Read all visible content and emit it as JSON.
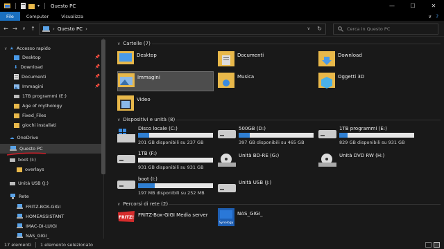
{
  "titlebar": {
    "title": "Questo PC",
    "min": "—",
    "max": "☐",
    "close": "✕"
  },
  "ribbon": {
    "tabs": [
      "File",
      "Computer",
      "Visualizza"
    ],
    "expand": "∨",
    "help": "?"
  },
  "address": {
    "back": "←",
    "forward": "→",
    "recent": "∨",
    "up": "↑",
    "crumb": "Questo PC",
    "chevron": "›",
    "search_placeholder": "Cerca in Questo PC"
  },
  "nav": {
    "quick_access": "Accesso rapido",
    "quick_items": [
      "Desktop",
      "Download",
      "Documenti",
      "Immagini",
      "1TB programmi (E:)",
      "Age of mythology",
      "Fixed_Files",
      "giochi installati"
    ],
    "onedrive": "OneDrive",
    "this_pc": "Questo PC",
    "boot": "boot (I:)",
    "overlays": "overlays",
    "usb": "Unità USB (J:)",
    "network": "Rete",
    "network_items": [
      "FRITZ-BOX-GIGI",
      "HOMEASSISTANT",
      "IMAC-DI-LUIGI",
      "NAS_GIGI_"
    ]
  },
  "content": {
    "folders_header": "Cartelle (7)",
    "folders": [
      "Desktop",
      "Documenti",
      "Download",
      "Immagini",
      "Musica",
      "Oggetti 3D",
      "Video"
    ],
    "drives_header": "Dispositivi e unità (8)",
    "drives": [
      {
        "name": "Disco locale (C:)",
        "info": "201 GB disponibili su 237 GB",
        "used": 0.15
      },
      {
        "name": "500GB (D:)",
        "info": "397 GB disponibili su 465 GB",
        "used": 0.15
      },
      {
        "name": "1TB programmi (E:)",
        "info": "829 GB disponibili su 931 GB",
        "used": 0.11
      },
      {
        "name": "1TB (F:)",
        "info": "931 GB disponibili su 931 GB",
        "used": 0.0
      },
      {
        "name": "Unità BD-RE (G:)",
        "info": ""
      },
      {
        "name": "Unità DVD RW (H:)",
        "info": ""
      },
      {
        "name": "boot (I:)",
        "info": "197 MB disponibili su 252 MB",
        "used": 0.22
      },
      {
        "name": "Unità USB (J:)",
        "info": ""
      }
    ],
    "network_header": "Percorsi di rete (2)",
    "network": [
      "FRITZ-Box-GIGI Media server",
      "NAS_GIGI_"
    ],
    "fritz_logo": "FRITZ!",
    "nas_logo": "Synology"
  },
  "status": {
    "count": "17 elementi",
    "selected": "1 elemento selezionato"
  },
  "colors": {
    "accent": "#1a6fbf",
    "bar_fill": "#2f7fd2",
    "folder": "#e8b84a"
  }
}
